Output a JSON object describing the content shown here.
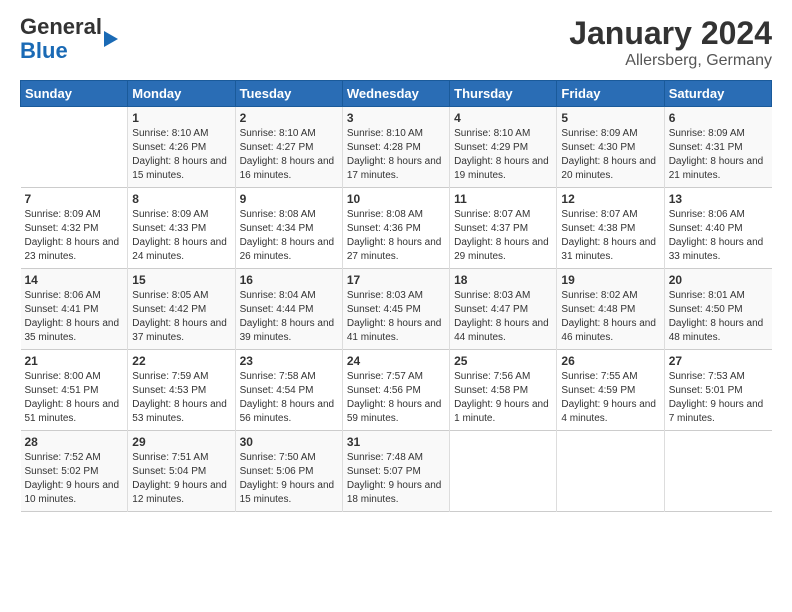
{
  "app": {
    "logo_general": "General",
    "logo_blue": "Blue"
  },
  "header": {
    "title": "January 2024",
    "location": "Allersberg, Germany"
  },
  "days_of_week": [
    "Sunday",
    "Monday",
    "Tuesday",
    "Wednesday",
    "Thursday",
    "Friday",
    "Saturday"
  ],
  "weeks": [
    [
      {
        "day": "",
        "sunrise": "",
        "sunset": "",
        "daylight": ""
      },
      {
        "day": "1",
        "sunrise": "Sunrise: 8:10 AM",
        "sunset": "Sunset: 4:26 PM",
        "daylight": "Daylight: 8 hours and 15 minutes."
      },
      {
        "day": "2",
        "sunrise": "Sunrise: 8:10 AM",
        "sunset": "Sunset: 4:27 PM",
        "daylight": "Daylight: 8 hours and 16 minutes."
      },
      {
        "day": "3",
        "sunrise": "Sunrise: 8:10 AM",
        "sunset": "Sunset: 4:28 PM",
        "daylight": "Daylight: 8 hours and 17 minutes."
      },
      {
        "day": "4",
        "sunrise": "Sunrise: 8:10 AM",
        "sunset": "Sunset: 4:29 PM",
        "daylight": "Daylight: 8 hours and 19 minutes."
      },
      {
        "day": "5",
        "sunrise": "Sunrise: 8:09 AM",
        "sunset": "Sunset: 4:30 PM",
        "daylight": "Daylight: 8 hours and 20 minutes."
      },
      {
        "day": "6",
        "sunrise": "Sunrise: 8:09 AM",
        "sunset": "Sunset: 4:31 PM",
        "daylight": "Daylight: 8 hours and 21 minutes."
      }
    ],
    [
      {
        "day": "7",
        "sunrise": "Sunrise: 8:09 AM",
        "sunset": "Sunset: 4:32 PM",
        "daylight": "Daylight: 8 hours and 23 minutes."
      },
      {
        "day": "8",
        "sunrise": "Sunrise: 8:09 AM",
        "sunset": "Sunset: 4:33 PM",
        "daylight": "Daylight: 8 hours and 24 minutes."
      },
      {
        "day": "9",
        "sunrise": "Sunrise: 8:08 AM",
        "sunset": "Sunset: 4:34 PM",
        "daylight": "Daylight: 8 hours and 26 minutes."
      },
      {
        "day": "10",
        "sunrise": "Sunrise: 8:08 AM",
        "sunset": "Sunset: 4:36 PM",
        "daylight": "Daylight: 8 hours and 27 minutes."
      },
      {
        "day": "11",
        "sunrise": "Sunrise: 8:07 AM",
        "sunset": "Sunset: 4:37 PM",
        "daylight": "Daylight: 8 hours and 29 minutes."
      },
      {
        "day": "12",
        "sunrise": "Sunrise: 8:07 AM",
        "sunset": "Sunset: 4:38 PM",
        "daylight": "Daylight: 8 hours and 31 minutes."
      },
      {
        "day": "13",
        "sunrise": "Sunrise: 8:06 AM",
        "sunset": "Sunset: 4:40 PM",
        "daylight": "Daylight: 8 hours and 33 minutes."
      }
    ],
    [
      {
        "day": "14",
        "sunrise": "Sunrise: 8:06 AM",
        "sunset": "Sunset: 4:41 PM",
        "daylight": "Daylight: 8 hours and 35 minutes."
      },
      {
        "day": "15",
        "sunrise": "Sunrise: 8:05 AM",
        "sunset": "Sunset: 4:42 PM",
        "daylight": "Daylight: 8 hours and 37 minutes."
      },
      {
        "day": "16",
        "sunrise": "Sunrise: 8:04 AM",
        "sunset": "Sunset: 4:44 PM",
        "daylight": "Daylight: 8 hours and 39 minutes."
      },
      {
        "day": "17",
        "sunrise": "Sunrise: 8:03 AM",
        "sunset": "Sunset: 4:45 PM",
        "daylight": "Daylight: 8 hours and 41 minutes."
      },
      {
        "day": "18",
        "sunrise": "Sunrise: 8:03 AM",
        "sunset": "Sunset: 4:47 PM",
        "daylight": "Daylight: 8 hours and 44 minutes."
      },
      {
        "day": "19",
        "sunrise": "Sunrise: 8:02 AM",
        "sunset": "Sunset: 4:48 PM",
        "daylight": "Daylight: 8 hours and 46 minutes."
      },
      {
        "day": "20",
        "sunrise": "Sunrise: 8:01 AM",
        "sunset": "Sunset: 4:50 PM",
        "daylight": "Daylight: 8 hours and 48 minutes."
      }
    ],
    [
      {
        "day": "21",
        "sunrise": "Sunrise: 8:00 AM",
        "sunset": "Sunset: 4:51 PM",
        "daylight": "Daylight: 8 hours and 51 minutes."
      },
      {
        "day": "22",
        "sunrise": "Sunrise: 7:59 AM",
        "sunset": "Sunset: 4:53 PM",
        "daylight": "Daylight: 8 hours and 53 minutes."
      },
      {
        "day": "23",
        "sunrise": "Sunrise: 7:58 AM",
        "sunset": "Sunset: 4:54 PM",
        "daylight": "Daylight: 8 hours and 56 minutes."
      },
      {
        "day": "24",
        "sunrise": "Sunrise: 7:57 AM",
        "sunset": "Sunset: 4:56 PM",
        "daylight": "Daylight: 8 hours and 59 minutes."
      },
      {
        "day": "25",
        "sunrise": "Sunrise: 7:56 AM",
        "sunset": "Sunset: 4:58 PM",
        "daylight": "Daylight: 9 hours and 1 minute."
      },
      {
        "day": "26",
        "sunrise": "Sunrise: 7:55 AM",
        "sunset": "Sunset: 4:59 PM",
        "daylight": "Daylight: 9 hours and 4 minutes."
      },
      {
        "day": "27",
        "sunrise": "Sunrise: 7:53 AM",
        "sunset": "Sunset: 5:01 PM",
        "daylight": "Daylight: 9 hours and 7 minutes."
      }
    ],
    [
      {
        "day": "28",
        "sunrise": "Sunrise: 7:52 AM",
        "sunset": "Sunset: 5:02 PM",
        "daylight": "Daylight: 9 hours and 10 minutes."
      },
      {
        "day": "29",
        "sunrise": "Sunrise: 7:51 AM",
        "sunset": "Sunset: 5:04 PM",
        "daylight": "Daylight: 9 hours and 12 minutes."
      },
      {
        "day": "30",
        "sunrise": "Sunrise: 7:50 AM",
        "sunset": "Sunset: 5:06 PM",
        "daylight": "Daylight: 9 hours and 15 minutes."
      },
      {
        "day": "31",
        "sunrise": "Sunrise: 7:48 AM",
        "sunset": "Sunset: 5:07 PM",
        "daylight": "Daylight: 9 hours and 18 minutes."
      },
      {
        "day": "",
        "sunrise": "",
        "sunset": "",
        "daylight": ""
      },
      {
        "day": "",
        "sunrise": "",
        "sunset": "",
        "daylight": ""
      },
      {
        "day": "",
        "sunrise": "",
        "sunset": "",
        "daylight": ""
      }
    ]
  ]
}
